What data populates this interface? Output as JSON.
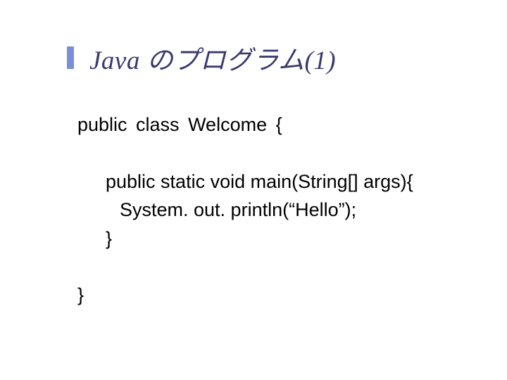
{
  "title": "Java のプログラム(1)",
  "code": {
    "l1": "public  class  Welcome {",
    "l2": "public static void main(String[] args){",
    "l3": "System. out. println(“Hello”);",
    "l4": "}",
    "l5": "}"
  }
}
